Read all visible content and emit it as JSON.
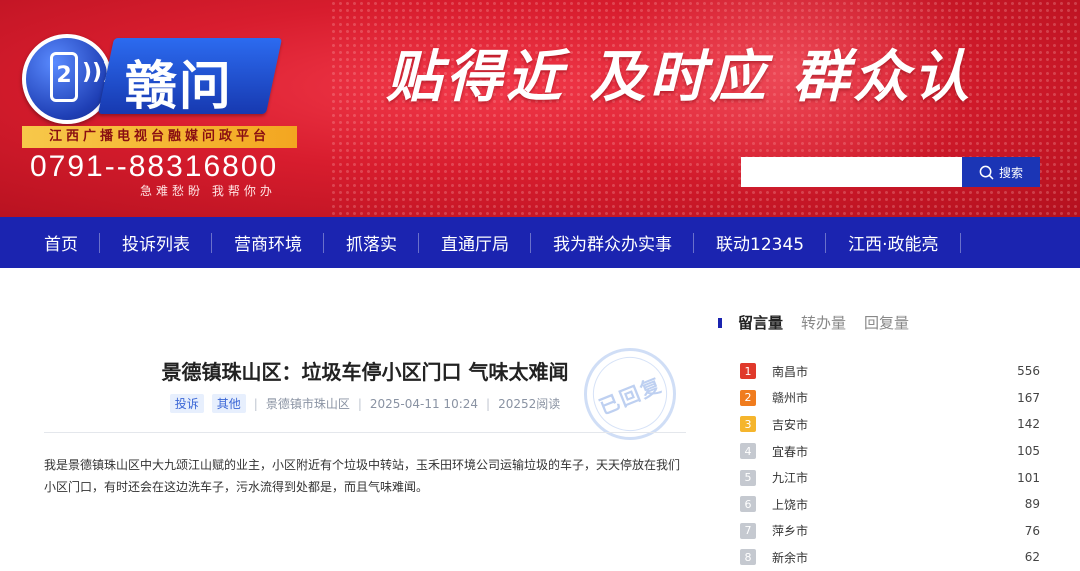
{
  "header": {
    "logo_text": "赣问",
    "logo_badge": "2",
    "platform_tag": "江西广播电视台融媒问政平台",
    "hotline": "0791--88316800",
    "hotline_sub": "急难愁盼  我帮你办",
    "slogan": "贴得近  及时应  群众认",
    "search": {
      "placeholder": "",
      "button_label": "搜索"
    },
    "colors": {
      "banner_red": "#d81d2e",
      "nav_blue": "#1b24b0",
      "gold": "#f3a620"
    }
  },
  "nav": {
    "items": [
      "首页",
      "投诉列表",
      "营商环境",
      "抓落实",
      "直通厅局",
      "我为群众办实事",
      "联动12345",
      "江西·政能亮"
    ]
  },
  "article": {
    "title": "景德镇珠山区：垃圾车停小区门口 气味太难闻",
    "tags": [
      "投诉",
      "其他"
    ],
    "location": "景德镇市珠山区",
    "datetime": "2025-04-11 10:24",
    "views": "20252阅读",
    "stamp": "已回复",
    "body": "我是景德镇珠山区中大九颂江山赋的业主，小区附近有个垃圾中转站，玉禾田环境公司运输垃圾的车子，天天停放在我们小区门口，有时还会在这边洗车子，污水流得到处都是，而且气味难闻。"
  },
  "sidebar": {
    "tabs": [
      "留言量",
      "转办量",
      "回复量"
    ],
    "active_tab": "留言量",
    "rank_colors": [
      "#e0392b",
      "#f07c1e",
      "#f5b52d",
      "#c5c9d0"
    ],
    "ranking": [
      {
        "rank": "1",
        "city": "南昌市",
        "count": "556"
      },
      {
        "rank": "2",
        "city": "赣州市",
        "count": "167"
      },
      {
        "rank": "3",
        "city": "吉安市",
        "count": "142"
      },
      {
        "rank": "4",
        "city": "宜春市",
        "count": "105"
      },
      {
        "rank": "5",
        "city": "九江市",
        "count": "101"
      },
      {
        "rank": "6",
        "city": "上饶市",
        "count": "89"
      },
      {
        "rank": "7",
        "city": "萍乡市",
        "count": "76"
      },
      {
        "rank": "8",
        "city": "新余市",
        "count": "62"
      }
    ]
  }
}
